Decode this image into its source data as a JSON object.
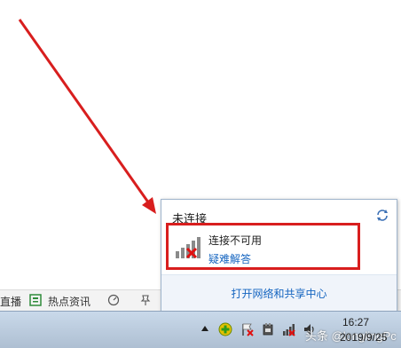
{
  "toolbar": {
    "live_label": "直播",
    "news_label": "热点资讯"
  },
  "network_popup": {
    "title": "未连接",
    "connection_status": "连接不可用",
    "troubleshoot_link": "疑难解答",
    "network_center_link": "打开网络和共享中心"
  },
  "taskbar": {
    "time": "16:27",
    "date": "2019/9/25",
    "watermark": "头条 @longlingPc"
  },
  "colors": {
    "annotation_red": "#d81e1e",
    "link_blue": "#1565c0"
  },
  "icons": {
    "refresh": "refresh-icon",
    "signal": "signal-bars-disconnected-icon",
    "tray_network": "network-disconnected-tray-icon"
  }
}
